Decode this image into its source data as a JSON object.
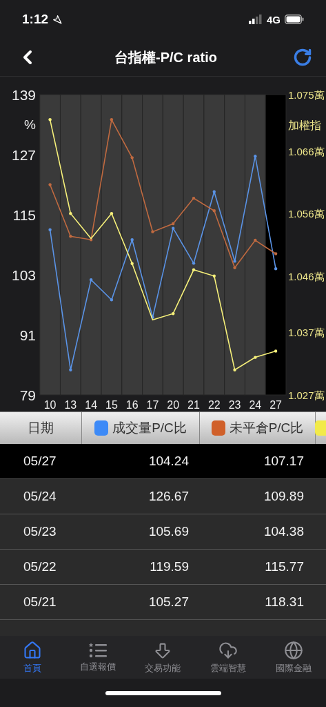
{
  "status_bar": {
    "time": "1:12",
    "network": "4G"
  },
  "header": {
    "title": "台指權-P/C ratio"
  },
  "chart": {
    "chart_data": {
      "type": "line",
      "categories": [
        "10",
        "13",
        "14",
        "15",
        "16",
        "17",
        "20",
        "21",
        "22",
        "23",
        "24",
        "27"
      ],
      "ylabel": "%",
      "ylim": [
        79,
        139
      ],
      "yticks": [
        79,
        91,
        103,
        115,
        127,
        139
      ],
      "y2label": "加權指",
      "y2lim": [
        1.027,
        1.075
      ],
      "y2ticks": [
        {
          "value": 1.027,
          "label": "1.027萬"
        },
        {
          "value": 1.037,
          "label": "1.037萬"
        },
        {
          "value": 1.046,
          "label": "1.046萬"
        },
        {
          "value": 1.056,
          "label": "1.056萬"
        },
        {
          "value": 1.066,
          "label": "1.066萬"
        },
        {
          "value": 1.075,
          "label": "1.075萬"
        }
      ],
      "bands": [
        {
          "axis": "x",
          "from": "27",
          "to": "27",
          "color": "#000000"
        }
      ],
      "series": [
        {
          "color": "#5a93e6",
          "values": [
            112,
            84,
            102,
            98,
            110,
            94.5,
            112.3,
            105.3,
            119.6,
            105.7,
            126.7,
            104.2
          ]
        },
        {
          "color": "#c06a40",
          "values": [
            121,
            110.7,
            110,
            134,
            126.4,
            111.6,
            113.2,
            118.3,
            115.8,
            104.4,
            109.9,
            107.2
          ]
        },
        {
          "color": "#f6f07a",
          "axis": "y2",
          "values": [
            1.071,
            1.056,
            1.052,
            1.056,
            1.048,
            1.039,
            1.04,
            1.047,
            1.046,
            1.031,
            1.033,
            1.034
          ]
        }
      ]
    }
  },
  "table": {
    "columns": [
      {
        "kind": "text",
        "label": "日期"
      },
      {
        "kind": "legend",
        "label": "成交量P/C比",
        "color": "#3d8af7"
      },
      {
        "kind": "legend",
        "label": "未平倉P/C比",
        "color": "#d0602a"
      },
      {
        "kind": "legend",
        "color": "#f2ea4a"
      }
    ],
    "rows": [
      {
        "selected": true,
        "cells": [
          "05/27",
          "104.24",
          "107.17"
        ]
      },
      {
        "selected": false,
        "cells": [
          "05/24",
          "126.67",
          "109.89"
        ]
      },
      {
        "selected": false,
        "cells": [
          "05/23",
          "105.69",
          "104.38"
        ]
      },
      {
        "selected": false,
        "cells": [
          "05/22",
          "119.59",
          "115.77"
        ]
      },
      {
        "selected": false,
        "cells": [
          "05/21",
          "105.27",
          "118.31"
        ]
      }
    ]
  },
  "tab_bar": [
    {
      "label": "首頁",
      "selected": true
    },
    {
      "label": "自選報價",
      "selected": false
    },
    {
      "label": "交易功能",
      "selected": false
    },
    {
      "label": "雲端智慧",
      "selected": false
    },
    {
      "label": "國際金融",
      "selected": false
    }
  ]
}
